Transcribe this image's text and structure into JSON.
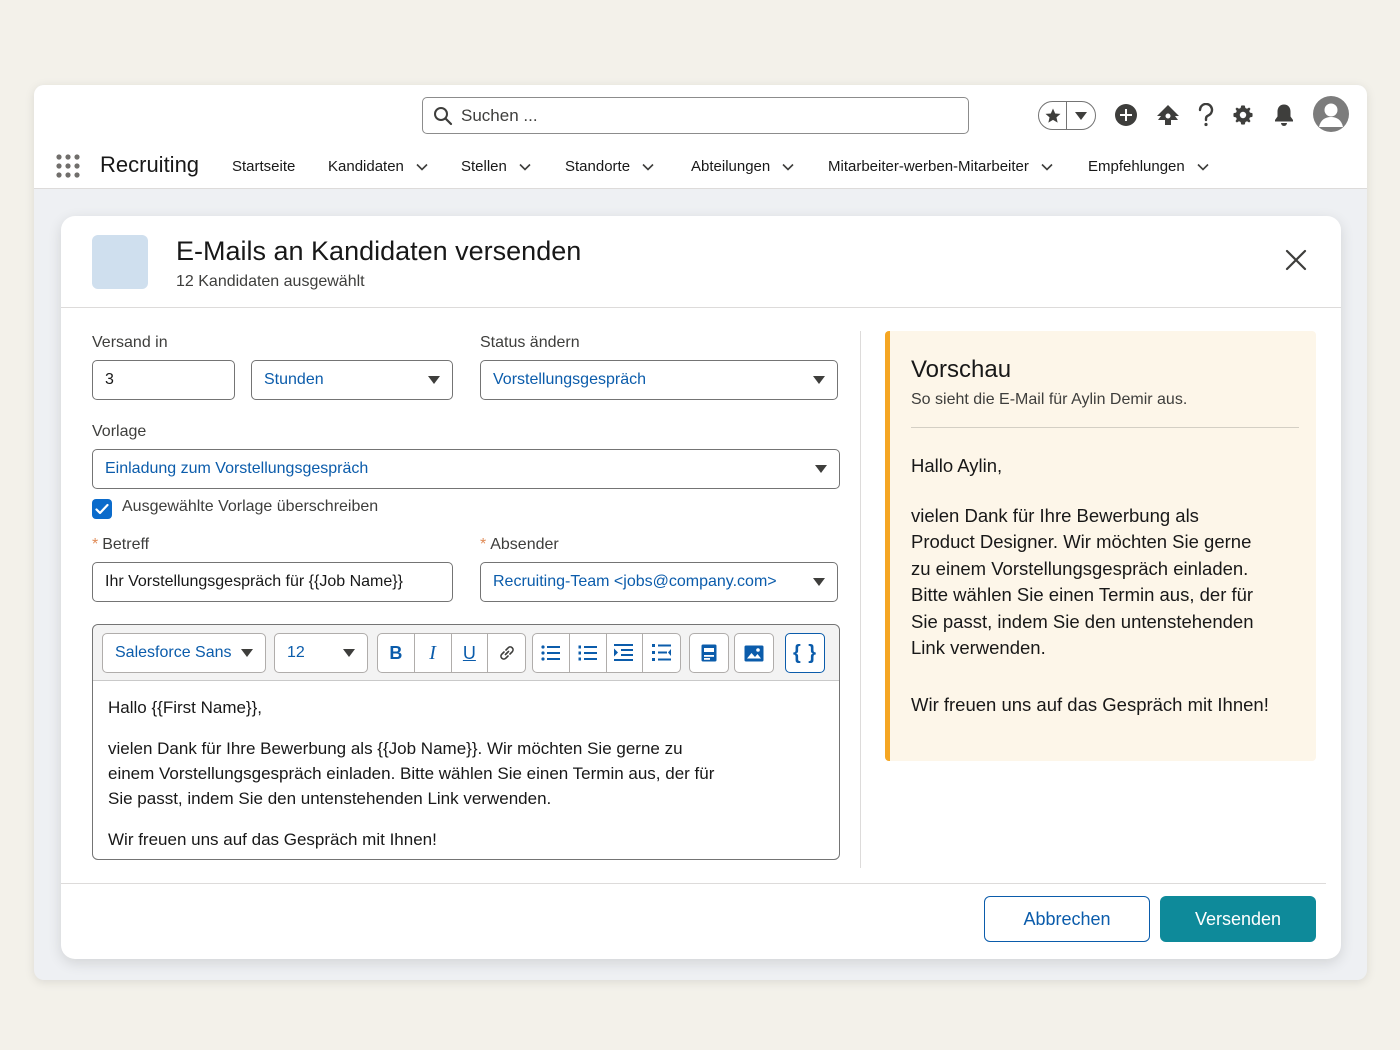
{
  "header": {
    "search_placeholder": "Suchen ...",
    "app_name": "Recruiting",
    "nav": [
      {
        "label": "Startseite",
        "dropdown": false
      },
      {
        "label": "Kandidaten",
        "dropdown": true
      },
      {
        "label": "Stellen",
        "dropdown": true
      },
      {
        "label": "Standorte",
        "dropdown": true
      },
      {
        "label": "Abteilungen",
        "dropdown": true
      },
      {
        "label": "Mitarbeiter-werben-Mitarbeiter",
        "dropdown": true
      },
      {
        "label": "Empfehlungen",
        "dropdown": true
      }
    ],
    "icons": [
      "favorites-star-icon",
      "add-icon",
      "trailhead-icon",
      "help-icon",
      "settings-gear-icon",
      "notifications-bell-icon",
      "user-avatar-icon"
    ]
  },
  "modal": {
    "title": "E-Mails an Kandidaten versenden",
    "subtitle": "12 Kandidaten ausgewählt",
    "send_in": {
      "label": "Versand in",
      "value": "3",
      "unit": "Stunden"
    },
    "status": {
      "label": "Status ändern",
      "value": "Vorstellungsgespräch"
    },
    "template": {
      "label": "Vorlage",
      "value": "Einladung zum Vorstellungsgespräch"
    },
    "override": {
      "label": "Ausgewählte Vorlage überschreiben",
      "checked": true
    },
    "subject": {
      "label": "Betreff",
      "required_mark": "*",
      "value": "Ihr Vorstellungsgespräch für {{Job Name}}"
    },
    "sender": {
      "label": "Absender",
      "required_mark": "*",
      "value": "Recruiting-Team <jobs@company.com>"
    },
    "editor": {
      "font": "Salesforce Sans",
      "size": "12",
      "bold": "B",
      "italic": "I",
      "underline": "U",
      "merge_field": "{ }",
      "body": [
        "Hallo {{First Name}},",
        "vielen Dank für Ihre Bewerbung als {{Job Name}}. Wir möchten Sie gerne zu einem Vorstellungsgespräch einladen. Bitte wählen Sie einen Termin aus, der für Sie passt, indem Sie den untenstehenden Link verwenden.",
        "Wir freuen uns auf das Gespräch mit Ihnen!"
      ]
    },
    "preview": {
      "title": "Vorschau",
      "subtitle": "So sieht die E-Mail für Aylin Demir aus.",
      "body": [
        "Hallo Aylin,",
        "vielen Dank für Ihre Bewerbung als Product Designer. Wir möchten Sie gerne zu einem Vorstellungsgespräch einladen. Bitte wählen Sie einen Termin aus, der für Sie passt, indem Sie den untenstehenden Link verwenden.",
        "Wir freuen uns auf das Gespräch mit Ihnen!"
      ]
    },
    "cancel_label": "Abbrechen",
    "send_label": "Versenden"
  },
  "colors": {
    "brand_blue": "#0b5cab",
    "send_button": "#0e8a9a",
    "preview_accent": "#f5a623",
    "preview_bg": "#fdf6e9"
  }
}
